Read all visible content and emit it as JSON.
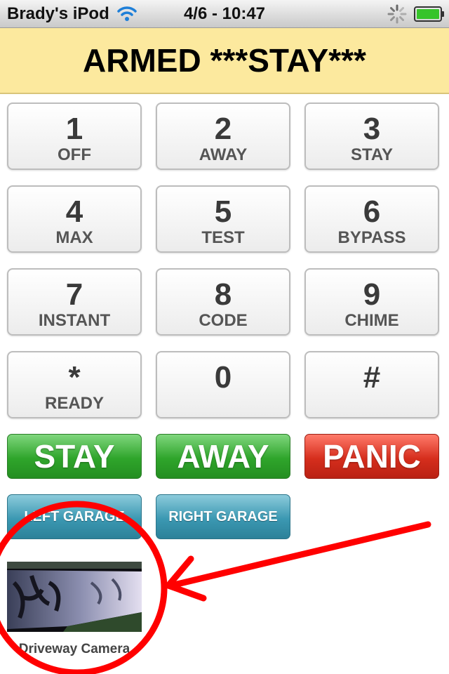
{
  "status_bar": {
    "carrier": "Brady's iPod",
    "time": "4/6 - 10:47"
  },
  "banner": {
    "status_text": "ARMED ***STAY***",
    "background_color": "#fce99e"
  },
  "keypad": {
    "keys": [
      {
        "digit": "1",
        "label": "OFF"
      },
      {
        "digit": "2",
        "label": "AWAY"
      },
      {
        "digit": "3",
        "label": "STAY"
      },
      {
        "digit": "4",
        "label": "MAX"
      },
      {
        "digit": "5",
        "label": "TEST"
      },
      {
        "digit": "6",
        "label": "BYPASS"
      },
      {
        "digit": "7",
        "label": "INSTANT"
      },
      {
        "digit": "8",
        "label": "CODE"
      },
      {
        "digit": "9",
        "label": "CHIME"
      },
      {
        "digit": "*",
        "label": "READY"
      },
      {
        "digit": "0",
        "label": ""
      },
      {
        "digit": "#",
        "label": ""
      }
    ]
  },
  "actions": {
    "stay_label": "STAY",
    "away_label": "AWAY",
    "panic_label": "PANIC",
    "green_color": "#2fa52b",
    "red_color": "#d62e1d"
  },
  "garage": {
    "left_label": "LEFT GARAGE",
    "right_label": "RIGHT GARAGE",
    "color": "#3b98b2"
  },
  "camera": {
    "label": "Driveway Camera"
  },
  "annotation": {
    "color": "#ff0000"
  },
  "icons": {
    "wifi": "wifi-icon",
    "activity": "activity-spinner-icon",
    "battery": "battery-icon"
  }
}
